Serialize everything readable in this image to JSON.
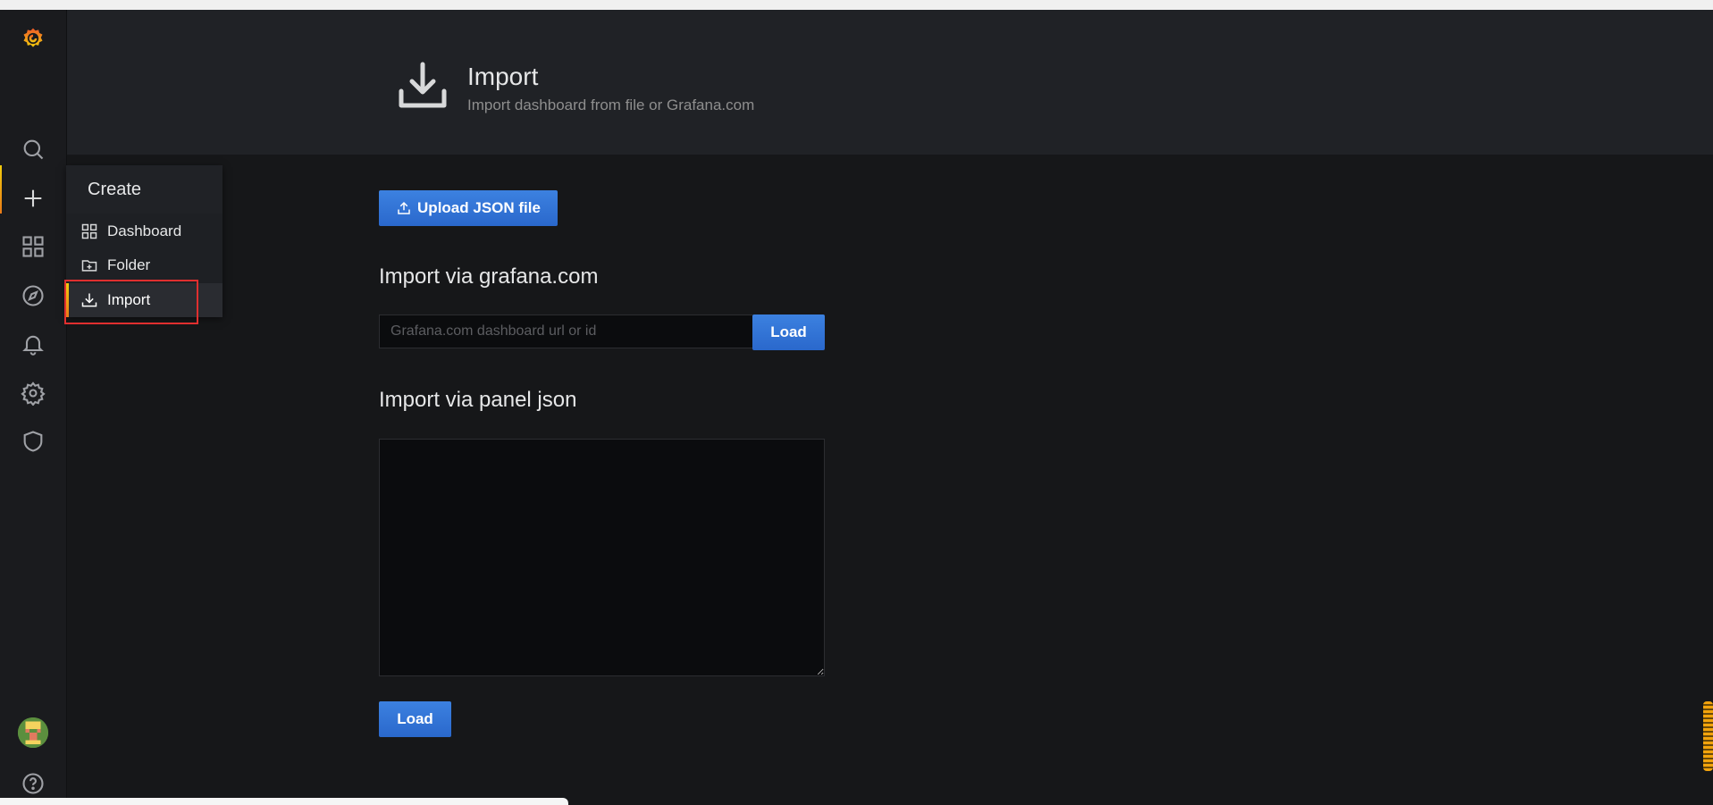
{
  "header": {
    "title": "Import",
    "subtitle": "Import dashboard from file or Grafana.com"
  },
  "upload": {
    "label": "Upload JSON file"
  },
  "grafana_import": {
    "title": "Import via grafana.com",
    "placeholder": "Grafana.com dashboard url or id",
    "load_label": "Load"
  },
  "panel_import": {
    "title": "Import via panel json",
    "load_label": "Load"
  },
  "create_menu": {
    "title": "Create",
    "items": [
      {
        "label": "Dashboard",
        "icon": "apps-icon"
      },
      {
        "label": "Folder",
        "icon": "folder-plus-icon"
      },
      {
        "label": "Import",
        "icon": "import-icon"
      }
    ]
  },
  "sidebar": {
    "icons": [
      "grafana-logo",
      "search-icon",
      "plus-icon",
      "apps-icon",
      "compass-icon",
      "bell-icon",
      "cog-icon",
      "shield-icon",
      "avatar",
      "help-icon"
    ]
  },
  "colors": {
    "accent": "#3274d9",
    "active_gradient_start": "#f2cc0c",
    "active_gradient_end": "#eb7b18",
    "highlight": "#e02f2f"
  }
}
